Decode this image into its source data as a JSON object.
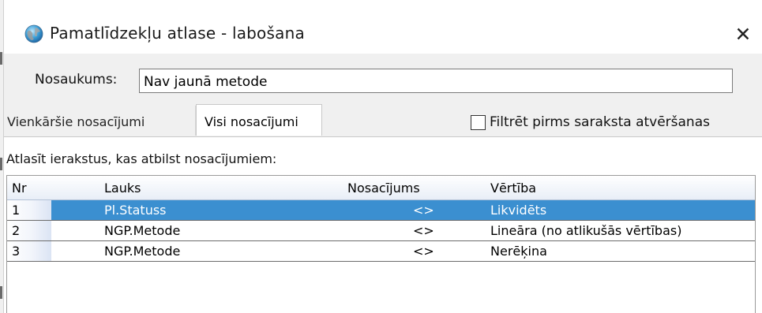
{
  "window": {
    "title": "Pamatlīdzekļu atlase - labošana",
    "close_glyph": "✕"
  },
  "form": {
    "name_label": "Nosaukums:",
    "name_value": "Nav jaunā metode"
  },
  "tabs": [
    {
      "label": "Vienkāršie nosacījumi",
      "active": false
    },
    {
      "label": "Visi nosacījumi",
      "active": true
    }
  ],
  "filter": {
    "label": "Filtrēt pirms saraksta atvēršanas",
    "checked": false
  },
  "criteria_label": "Atlasīt ierakstus, kas atbilst nosacījumiem:",
  "grid": {
    "columns": [
      "Nr",
      "Lauks",
      "Nosacījums",
      "Vērtība"
    ],
    "rows": [
      {
        "nr": "1",
        "field": "Pl.Statuss",
        "condition": "<>",
        "value": "Likvidēts",
        "selected": true
      },
      {
        "nr": "2",
        "field": "NGP.Metode",
        "condition": "<>",
        "value": "Lineāra (no atlikušās vērtības)",
        "selected": false
      },
      {
        "nr": "3",
        "field": "NGP.Metode",
        "condition": "<>",
        "value": "Nerēķina",
        "selected": false
      }
    ]
  },
  "colors": {
    "selection": "#3b8fd0",
    "dialog_bg": "#f0f0f0",
    "header_gradient_end": "#e8eef7"
  },
  "icons": {
    "app": "globe-icon",
    "close": "close-icon",
    "checkbox": "checkbox-icon"
  }
}
